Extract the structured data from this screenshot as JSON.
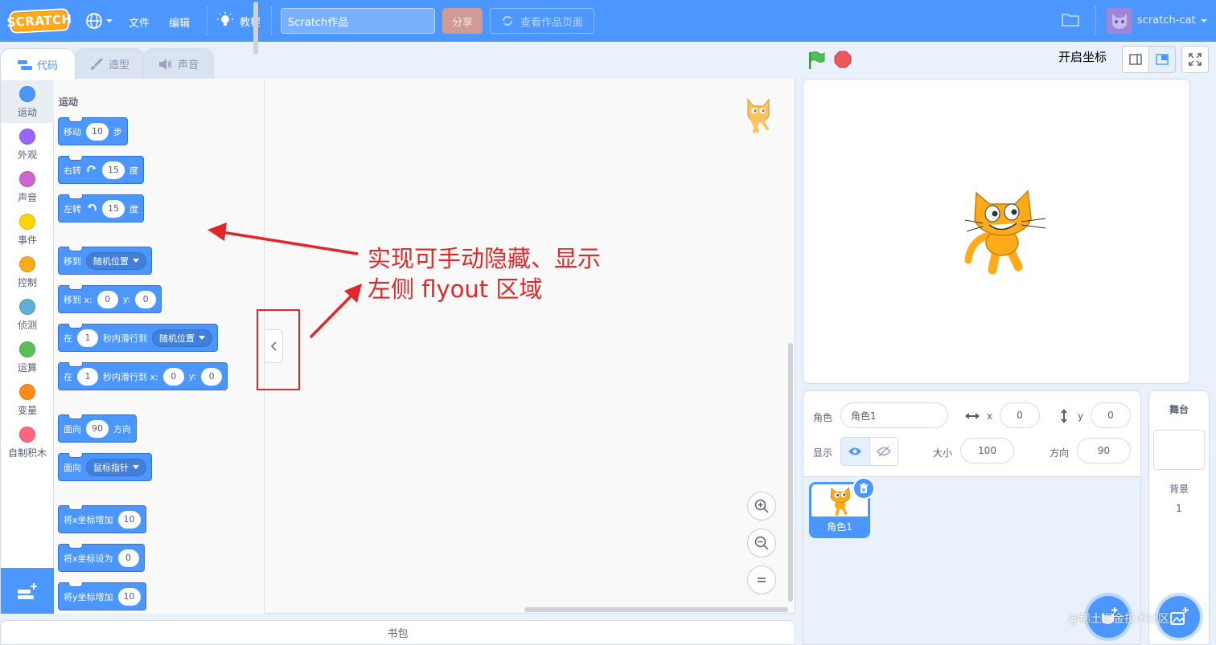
{
  "menubar": {
    "logo": "SCRATCH",
    "file": "文件",
    "edit": "编辑",
    "tutorials": "教程",
    "project_title": "Scratch作品",
    "share": "分享",
    "see_project_page": "查看作品页面",
    "username": "scratch-cat",
    "accent": "#4c97ff"
  },
  "tabs": {
    "code": "代码",
    "costumes": "造型",
    "sounds": "声音"
  },
  "categories": [
    {
      "label": "运动",
      "color": "#4c97ff"
    },
    {
      "label": "外观",
      "color": "#9966ff"
    },
    {
      "label": "声音",
      "color": "#cf63cf"
    },
    {
      "label": "事件",
      "color": "#ffd500"
    },
    {
      "label": "控制",
      "color": "#ffab19"
    },
    {
      "label": "侦测",
      "color": "#5cb1d6"
    },
    {
      "label": "运算",
      "color": "#59c059"
    },
    {
      "label": "变量",
      "color": "#ff8c1a"
    },
    {
      "label": "自制积木",
      "color": "#ff6680"
    }
  ],
  "flyout": {
    "section": "运动",
    "blocks": {
      "move": {
        "t1": "移动",
        "v1": "10",
        "t2": "步"
      },
      "turn_right": {
        "t1": "右转",
        "v1": "15",
        "t2": "度"
      },
      "turn_left": {
        "t1": "左转",
        "v1": "15",
        "t2": "度"
      },
      "goto": {
        "t1": "移到",
        "d1": "随机位置"
      },
      "goto_xy": {
        "t1": "移到 x:",
        "v1": "0",
        "t2": "y:",
        "v2": "0"
      },
      "glide_to": {
        "t1": "在",
        "v1": "1",
        "t2": "秒内滑行到",
        "d1": "随机位置"
      },
      "glide_xy": {
        "t1": "在",
        "v1": "1",
        "t2": "秒内滑行到 x:",
        "v2": "0",
        "t3": "y:",
        "v3": "0"
      },
      "point_dir": {
        "t1": "面向",
        "v1": "90",
        "t2": "方向"
      },
      "point_towards": {
        "t1": "面向",
        "d1": "鼠标指针"
      },
      "change_x": {
        "t1": "将x坐标增加",
        "v1": "10"
      },
      "set_x": {
        "t1": "将x坐标设为",
        "v1": "0"
      },
      "change_y": {
        "t1": "将y坐标增加",
        "v1": "10"
      }
    }
  },
  "annotation": {
    "line1": "实现可手动隐藏、显示",
    "line2": "左侧 flyout 区域",
    "color": "#e0282a"
  },
  "backpack": "书包",
  "stage_header": {
    "coord_toggle": "开启坐标"
  },
  "sprite_info": {
    "sprite_label": "角色",
    "sprite_name": "角色1",
    "x_label": "x",
    "x_value": "0",
    "y_label": "y",
    "y_value": "0",
    "show_label": "显示",
    "size_label": "大小",
    "size_value": "100",
    "direction_label": "方向",
    "direction_value": "90"
  },
  "sprites": [
    {
      "name": "角色1"
    }
  ],
  "stage_selector": {
    "title": "舞台",
    "backdrop_label": "背景",
    "backdrop_count": "1"
  },
  "watermark": "@稀土掘金技术社区"
}
